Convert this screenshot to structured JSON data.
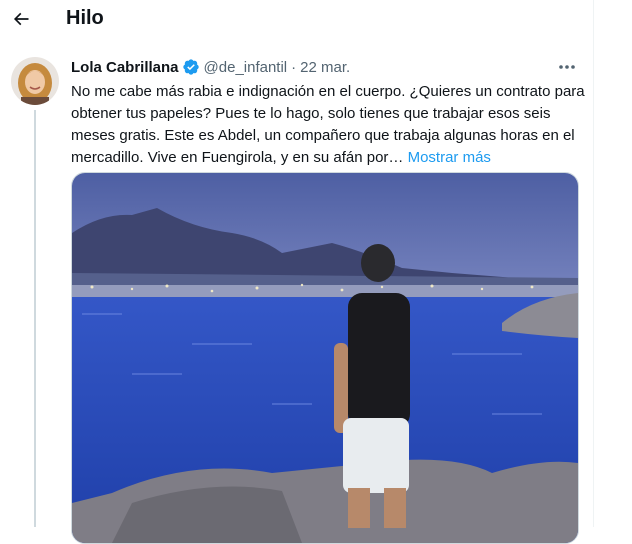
{
  "header": {
    "title": "Hilo"
  },
  "tweet": {
    "author_name": "Lola Cabrillana",
    "handle": "@de_infantil",
    "separator": "·",
    "date": "22 mar.",
    "text": "No me cabe más rabia e indignación en el cuerpo. ¿Quieres un contrato para obtener tus papeles? Pues te lo hago, solo tienes que trabajar esos seis meses gratis. Este es Abdel, un compañero que trabaja  algunas horas en el mercadillo. Vive en Fuengirola, y en su afán por… ",
    "show_more": "Mostrar más"
  },
  "colors": {
    "accent": "#1d9bf0",
    "verified": "#1d9bf0",
    "text": "#0f1419",
    "secondary": "#536471"
  },
  "icons": {
    "back": "arrow-left-icon",
    "verified": "verified-badge-icon",
    "more": "more-dots-icon"
  }
}
